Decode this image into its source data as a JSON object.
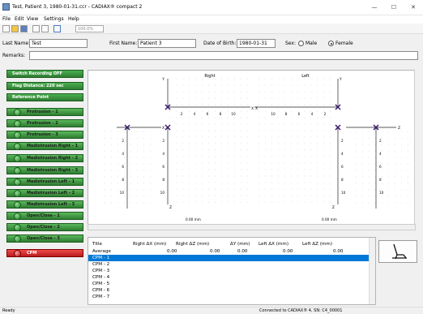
{
  "window": {
    "title": "Test, Patient 3, 1980-01-31.ccr - CADIAX® compact 2"
  },
  "menu": [
    "File",
    "Edit",
    "View",
    "Settings",
    "Help"
  ],
  "toolbar": {
    "zoom": "100.0%",
    "icons": [
      "new-document-icon",
      "open-folder-icon",
      "save-icon",
      "print-preview-icon",
      "print-icon",
      "zoom-icon"
    ]
  },
  "patient": {
    "last_name_label": "Last Name:",
    "last_name": "Test",
    "first_name_label": "First Name:",
    "first_name": "Patient 3",
    "dob_label": "Date of Birth:",
    "dob": "1980-01-31",
    "sex_label": "Sex:",
    "male_label": "Male",
    "female_label": "Female",
    "sex_selected": "Female",
    "remarks_label": "Remarks:",
    "remarks": ""
  },
  "control_buttons": [
    "Switch Recording OFF",
    "Flag Distance: 220 sec",
    "Reference Point"
  ],
  "motion_buttons": [
    "Protrusion - 1",
    "Protrusion - 2",
    "Protrusion - 3",
    "Mediotrusion Right - 1",
    "Mediotrusion Right - 2",
    "Mediotrusion Right - 3",
    "Mediotrusion Left - 1",
    "Mediotrusion Left - 2",
    "Mediotrusion Left - 3",
    "Open/Close - 1",
    "Open/Close - 2",
    "Open/Close - 3"
  ],
  "cpm_button": "CPM",
  "graph": {
    "right_title": "Right",
    "left_title": "Left",
    "axis_x": "X",
    "axis_y": "Y",
    "axis_z": "Z",
    "unit_right": "0.00 mm",
    "unit_left": "0.00 mm",
    "tick_labels_main": [
      "2",
      "4",
      "6",
      "8",
      "10"
    ],
    "tick_labels_side": [
      "2",
      "4",
      "6",
      "8",
      "10"
    ]
  },
  "table": {
    "columns": [
      "Title",
      "Right ΔX (mm)",
      "Right ΔZ (mm)",
      "ΔY (mm)",
      "Left ΔX (mm)",
      "Left ΔZ (mm)"
    ],
    "rows": [
      {
        "title": "Average",
        "rx": "0.00",
        "rz": "0.00",
        "dy": "0.00",
        "lx": "0.00",
        "lz": "0.00"
      },
      {
        "title": "CPM - 1",
        "rx": "",
        "rz": "",
        "dy": "",
        "lx": "",
        "lz": ""
      },
      {
        "title": "CPM - 2",
        "rx": "",
        "rz": "",
        "dy": "",
        "lx": "",
        "lz": ""
      },
      {
        "title": "CPM - 3",
        "rx": "",
        "rz": "",
        "dy": "",
        "lx": "",
        "lz": ""
      },
      {
        "title": "CPM - 4",
        "rx": "",
        "rz": "",
        "dy": "",
        "lx": "",
        "lz": ""
      },
      {
        "title": "CPM - 5",
        "rx": "",
        "rz": "",
        "dy": "",
        "lx": "",
        "lz": ""
      },
      {
        "title": "CPM - 6",
        "rx": "",
        "rz": "",
        "dy": "",
        "lx": "",
        "lz": ""
      },
      {
        "title": "CPM - 7",
        "rx": "",
        "rz": "",
        "dy": "",
        "lx": "",
        "lz": ""
      }
    ],
    "selected_row": 1
  },
  "status": {
    "left": "Ready",
    "right": "Connected to CADIAX® 4, SN: C4_00001"
  },
  "colors": {
    "green": "#2e7d32",
    "red": "#c62828",
    "selection": "#0078d7",
    "marker": "#3a1a6e"
  }
}
